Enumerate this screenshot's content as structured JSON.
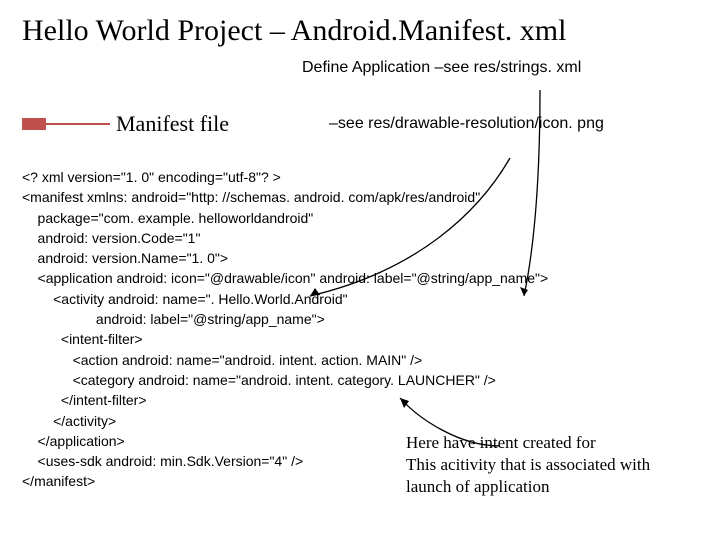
{
  "title": "Hello World Project – Android.Manifest. xml",
  "subtitle_right": "Define Application –see res/strings. xml",
  "section_label": "Manifest file",
  "see_drawable": "–see res/drawable-resolution/icon. png",
  "code": "<? xml version=\"1. 0\" encoding=\"utf-8\"? >\n<manifest xmlns: android=\"http: //schemas. android. com/apk/res/android\"\n    package=\"com. example. helloworldandroid\"\n    android: version.Code=\"1\"\n    android: version.Name=\"1. 0\">\n    <application android: icon=\"@drawable/icon\" android: label=\"@string/app_name\">\n        <activity android: name=\". Hello.World.Android\"\n                   android: label=\"@string/app_name\">\n          <intent-filter>\n             <action android: name=\"android. intent. action. MAIN\" />\n             <category android: name=\"android. intent. category. LAUNCHER\" />\n          </intent-filter>\n        </activity>\n    </application>\n    <uses-sdk android: min.Sdk.Version=\"4\" />\n</manifest>",
  "annotation_line1": "Here have intent created for",
  "annotation_line2": "This acitivity that is associated with",
  "annotation_line3": "launch of application"
}
